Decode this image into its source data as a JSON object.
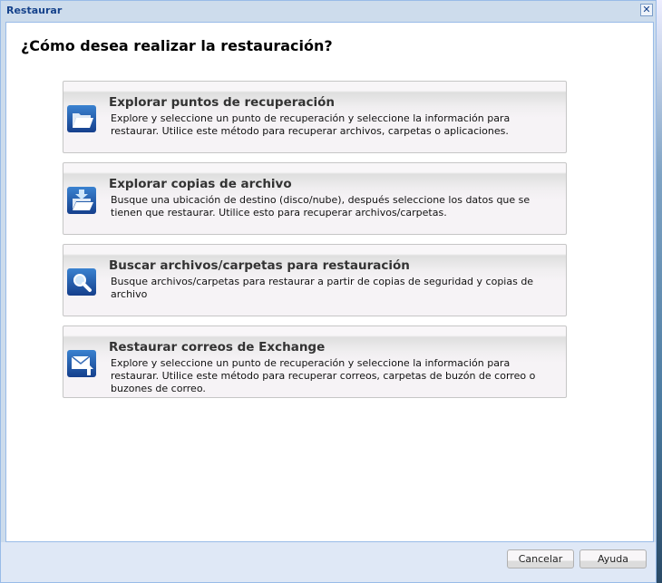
{
  "window": {
    "title": "Restaurar",
    "close_icon": "close-icon"
  },
  "question": "¿Cómo desea realizar la restauración?",
  "options": [
    {
      "title": "Explorar puntos de recuperación",
      "description": "Explore y seleccione un punto de recuperación y seleccione la información para restaurar. Utilice este método para recuperar archivos, carpetas o aplicaciones.",
      "icon": "folder-icon"
    },
    {
      "title": "Explorar copias de archivo",
      "description": "Busque una ubicación de destino (disco/nube), después seleccione los datos que se tienen que restaurar. Utilice esto para recuperar archivos/carpetas.",
      "icon": "folder-download-icon"
    },
    {
      "title": "Buscar archivos/carpetas para restauración",
      "description": "Busque archivos/carpetas para restaurar a partir de copias de seguridad y copias de archivo",
      "icon": "search-icon"
    },
    {
      "title": "Restaurar correos de Exchange",
      "description": "Explore y seleccione un punto de recuperación y seleccione la información para restaurar. Utilice este método para recuperar correos, carpetas de buzón de correo o buzones de correo.",
      "icon": "mail-icon"
    }
  ],
  "footer": {
    "cancel": "Cancelar",
    "help": "Ayuda"
  }
}
